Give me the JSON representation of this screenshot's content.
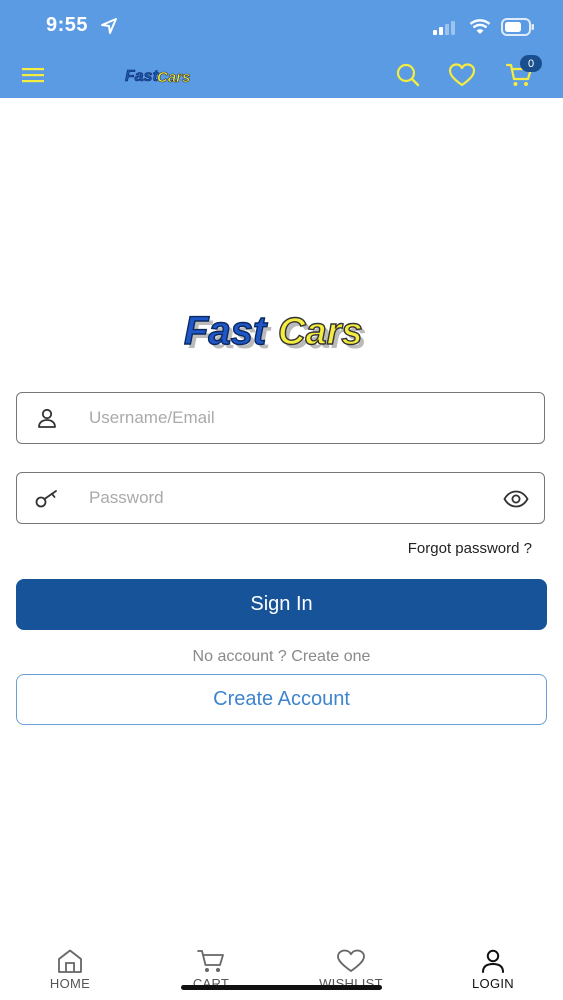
{
  "status_bar": {
    "time": "9:55"
  },
  "app_bar": {
    "logo": "FastCars",
    "cart_count": "0"
  },
  "login": {
    "logo": "FastCars",
    "username_placeholder": "Username/Email",
    "password_placeholder": "Password",
    "forgot_password": "Forgot password ?",
    "sign_in": "Sign In",
    "no_account": "No account ? Create one",
    "create_account": "Create Account"
  },
  "bottom_nav": {
    "home": "HOME",
    "cart": "CART",
    "wishlist": "WISHLIST",
    "login": "LOGIN"
  },
  "colors": {
    "header": "#5b9be3",
    "accent_yellow": "#f4ec3e",
    "primary_button": "#175399",
    "secondary_text": "#3f84cf"
  }
}
